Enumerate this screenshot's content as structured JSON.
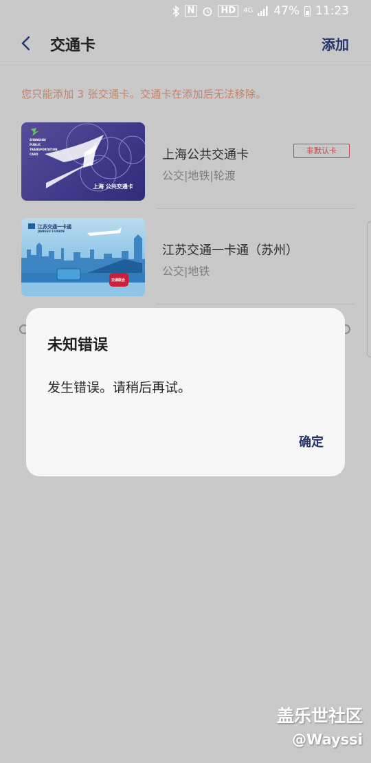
{
  "status_bar": {
    "battery": "47%",
    "time": "11:23",
    "hd_badge": "HD",
    "network": "4G",
    "nfc": "N"
  },
  "header": {
    "back_icon": "chevron-left-icon",
    "title": "交通卡",
    "add_label": "添加"
  },
  "notice": "您只能添加 3 张交通卡。交通卡在添加后无法移除。",
  "cards": [
    {
      "name": "上海公共交通卡",
      "services": "公交|地铁|轮渡",
      "badge": "非默认卡",
      "image_text": "上海 公共交通卡",
      "image_text_en": "SHANGHAI PUBLIC TRANSPORTATION CARD"
    },
    {
      "name": "江苏交通一卡通（苏州）",
      "services": "公交|地铁",
      "image_text": "江苏交通一卡通",
      "image_text_en": "JIANGSU T-UNION",
      "image_badge": "交通联合"
    }
  ],
  "dialog": {
    "title": "未知错误",
    "message": "发生错误。请稍后再试。",
    "confirm_label": "确定"
  },
  "watermark": {
    "site": "盖乐世社区",
    "handle": "@Wayssi"
  },
  "colors": {
    "accent": "#23346b",
    "notice": "#c58168",
    "badge": "#c0474a",
    "scrim_background": "#c9c9c9",
    "dialog_background": "#f7f7f7"
  }
}
